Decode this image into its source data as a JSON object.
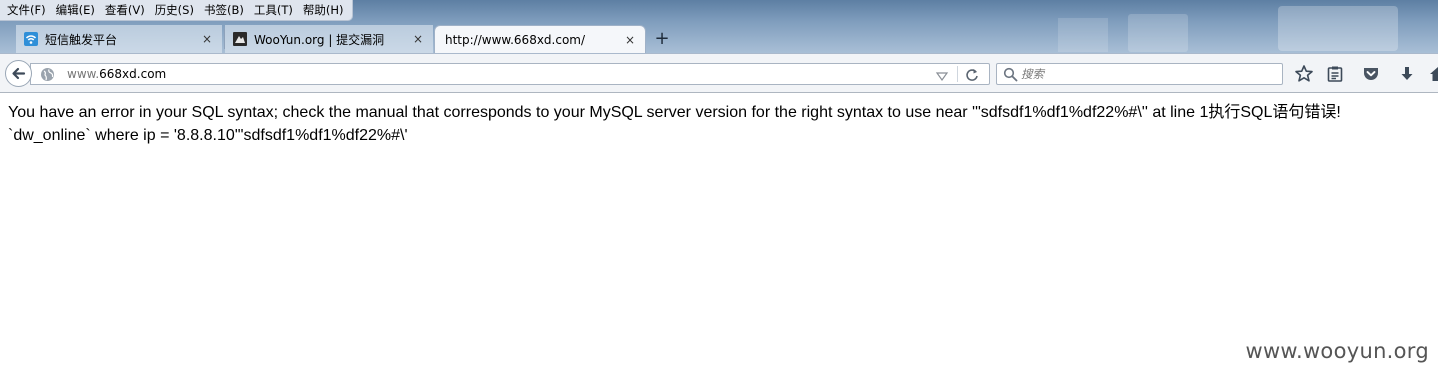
{
  "menubar": {
    "items": [
      "文件(F)",
      "编辑(E)",
      "查看(V)",
      "历史(S)",
      "书签(B)",
      "工具(T)",
      "帮助(H)"
    ]
  },
  "tabs": [
    {
      "label": "短信触发平台",
      "icon": "wifi-signal-icon",
      "close": "×"
    },
    {
      "label": "WooYun.org | 提交漏洞",
      "icon": "wooyun-logo-icon",
      "close": "×"
    },
    {
      "label": "http://www.668xd.com/",
      "icon": "",
      "close": "×"
    }
  ],
  "new_tab_label": "+",
  "address": {
    "prefix": "www.",
    "domain": "668xd.com"
  },
  "search": {
    "placeholder": "搜索",
    "value": ""
  },
  "page": {
    "error_line1": "You have an error in your SQL syntax; check the manual that corresponds to your MySQL server version for the right syntax to use near '\"sdfsdf1%df1%df22%#\\'' at line 1执行SQL语句错误!",
    "error_line2": "`dw_online` where ip = '8.8.8.10'\"sdfsdf1%df1%df22%#\\'"
  },
  "watermark": "www.wooyun.org",
  "colors": {
    "chrome_gradient_top": "#5d7fa3",
    "chrome_gradient_bottom": "#a9bfd6",
    "toolbar_bg": "#f2f4f7",
    "pocket_icon": "#8a95a3"
  }
}
